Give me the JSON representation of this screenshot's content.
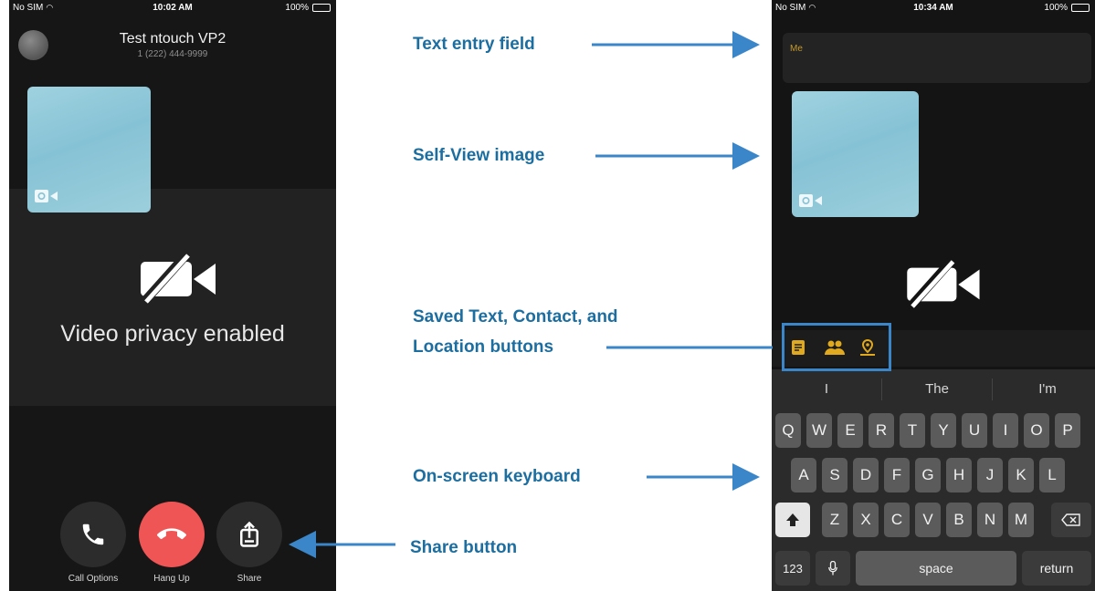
{
  "left_phone": {
    "status": {
      "carrier": "No SIM",
      "time": "10:02 AM",
      "battery": "100%"
    },
    "caller": {
      "name": "Test ntouch VP2",
      "number": "1 (222) 444-9999"
    },
    "privacy_message": "Video privacy enabled",
    "buttons": {
      "call_options": "Call Options",
      "hang_up": "Hang Up",
      "share": "Share"
    }
  },
  "right_phone": {
    "status": {
      "carrier": "No SIM",
      "time": "10:34 AM",
      "battery": "100%"
    },
    "text_entry": {
      "sender_label": "Me"
    },
    "suggestions": [
      "I",
      "The",
      "I'm"
    ],
    "keyboard": {
      "row1": [
        "Q",
        "W",
        "E",
        "R",
        "T",
        "Y",
        "U",
        "I",
        "O",
        "P"
      ],
      "row2": [
        "A",
        "S",
        "D",
        "F",
        "G",
        "H",
        "J",
        "K",
        "L"
      ],
      "row3": [
        "Z",
        "X",
        "C",
        "V",
        "B",
        "N",
        "M"
      ],
      "numbers_key": "123",
      "space_key": "space",
      "return_key": "return"
    }
  },
  "callouts": {
    "text_entry": "Text entry field",
    "self_view": "Self-View image",
    "saved_buttons_line1": "Saved Text, Contact, and",
    "saved_buttons_line2": "Location buttons",
    "keyboard": "On-screen keyboard",
    "share": "Share button"
  },
  "colors": {
    "callout_text": "#1c6ea0",
    "arrow": "#3a86c8",
    "hang_up": "#f05555",
    "accessory_icons": "#e0a91e",
    "self_view": "#8fc8d9"
  }
}
